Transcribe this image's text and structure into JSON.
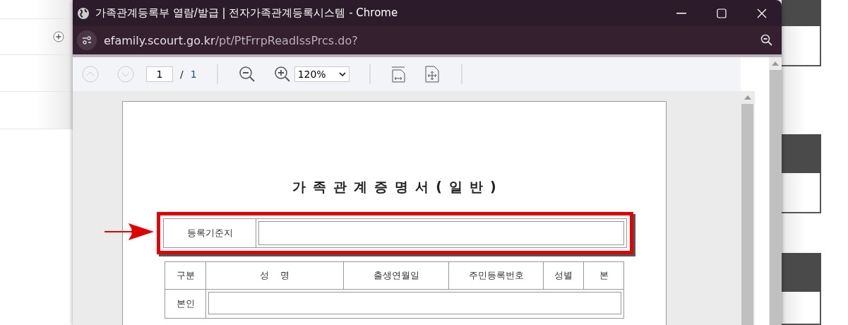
{
  "window": {
    "title": "가족관계등록부 열람/발급 | 전자가족관계등록시스템 - Chrome",
    "url_host": "efamily.scourt.go.kr",
    "url_path": "/pt/PtFrrpReadIssPrcs.do?"
  },
  "pdf_toolbar": {
    "page_input": "1",
    "page_separator": "/",
    "page_total": "1",
    "zoom": "120%"
  },
  "document": {
    "title": "가족관계증명서(일반)",
    "registration": {
      "label": "등록기준지",
      "highlighted": true
    },
    "table": {
      "columns": [
        "구분",
        "성    명",
        "출생연월일",
        "주민등록번호",
        "성별",
        "본"
      ],
      "rows": [
        {
          "label": "본인"
        }
      ]
    }
  }
}
